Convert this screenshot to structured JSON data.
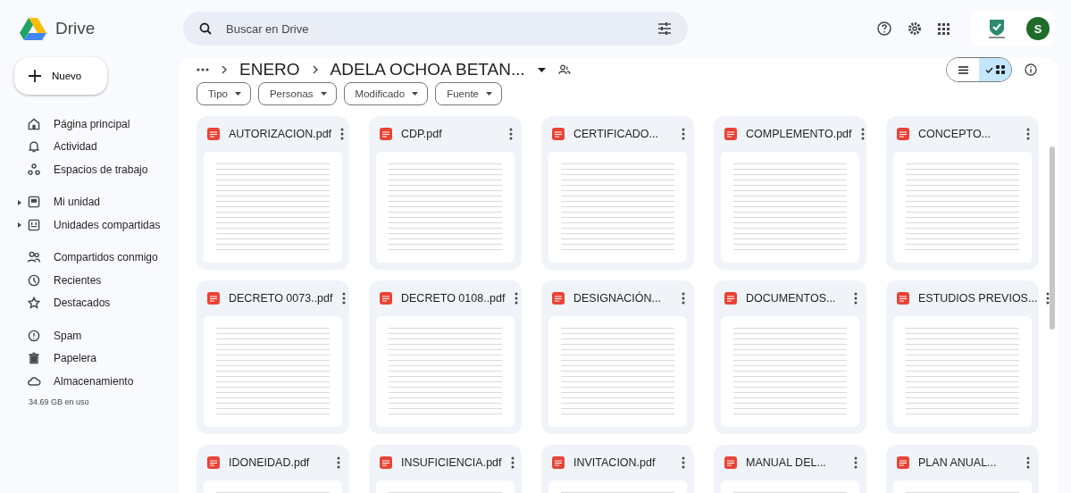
{
  "app": {
    "name": "Drive"
  },
  "search": {
    "placeholder": "Buscar en Drive"
  },
  "account": {
    "initial": "S"
  },
  "new_button": {
    "label": "Nuevo"
  },
  "sidebar": {
    "groups": [
      [
        {
          "label": "Página principal",
          "expandable": false
        },
        {
          "label": "Actividad",
          "expandable": false
        },
        {
          "label": "Espacios de trabajo",
          "expandable": false
        }
      ],
      [
        {
          "label": "Mi unidad",
          "expandable": true
        },
        {
          "label": "Unidades compartidas",
          "expandable": true
        }
      ],
      [
        {
          "label": "Compartidos conmigo",
          "expandable": false
        },
        {
          "label": "Recientes",
          "expandable": false
        },
        {
          "label": "Destacados",
          "expandable": false
        }
      ],
      [
        {
          "label": "Spam",
          "expandable": false
        },
        {
          "label": "Papelera",
          "expandable": false
        },
        {
          "label": "Almacenamiento",
          "expandable": false
        }
      ]
    ],
    "storage": "34.69 GB en uso"
  },
  "breadcrumb": [
    "ENERO",
    "ADELA OCHOA BETAN..."
  ],
  "view_toggle": [
    {
      "selected": false
    },
    {
      "selected": true
    }
  ],
  "filters": [
    "Tipo",
    "Personas",
    "Modificado",
    "Fuente"
  ],
  "files": [
    {
      "name": "AUTORIZACION.pdf"
    },
    {
      "name": "CDP.pdf"
    },
    {
      "name": "CERTIFICADO..."
    },
    {
      "name": "COMPLEMENTO.pdf"
    },
    {
      "name": "CONCEPTO..."
    },
    {
      "name": "DECRETO 0073..pdf"
    },
    {
      "name": "DECRETO 0108..pdf"
    },
    {
      "name": "DESIGNACIÓN..."
    },
    {
      "name": "DOCUMENTOS..."
    },
    {
      "name": "ESTUDIOS PREVIOS..."
    },
    {
      "name": "IDONEIDAD.pdf"
    },
    {
      "name": "INSUFICIENCIA.pdf"
    },
    {
      "name": "INVITACION.pdf"
    },
    {
      "name": "MANUAL DEL..."
    },
    {
      "name": "PLAN ANUAL..."
    }
  ]
}
